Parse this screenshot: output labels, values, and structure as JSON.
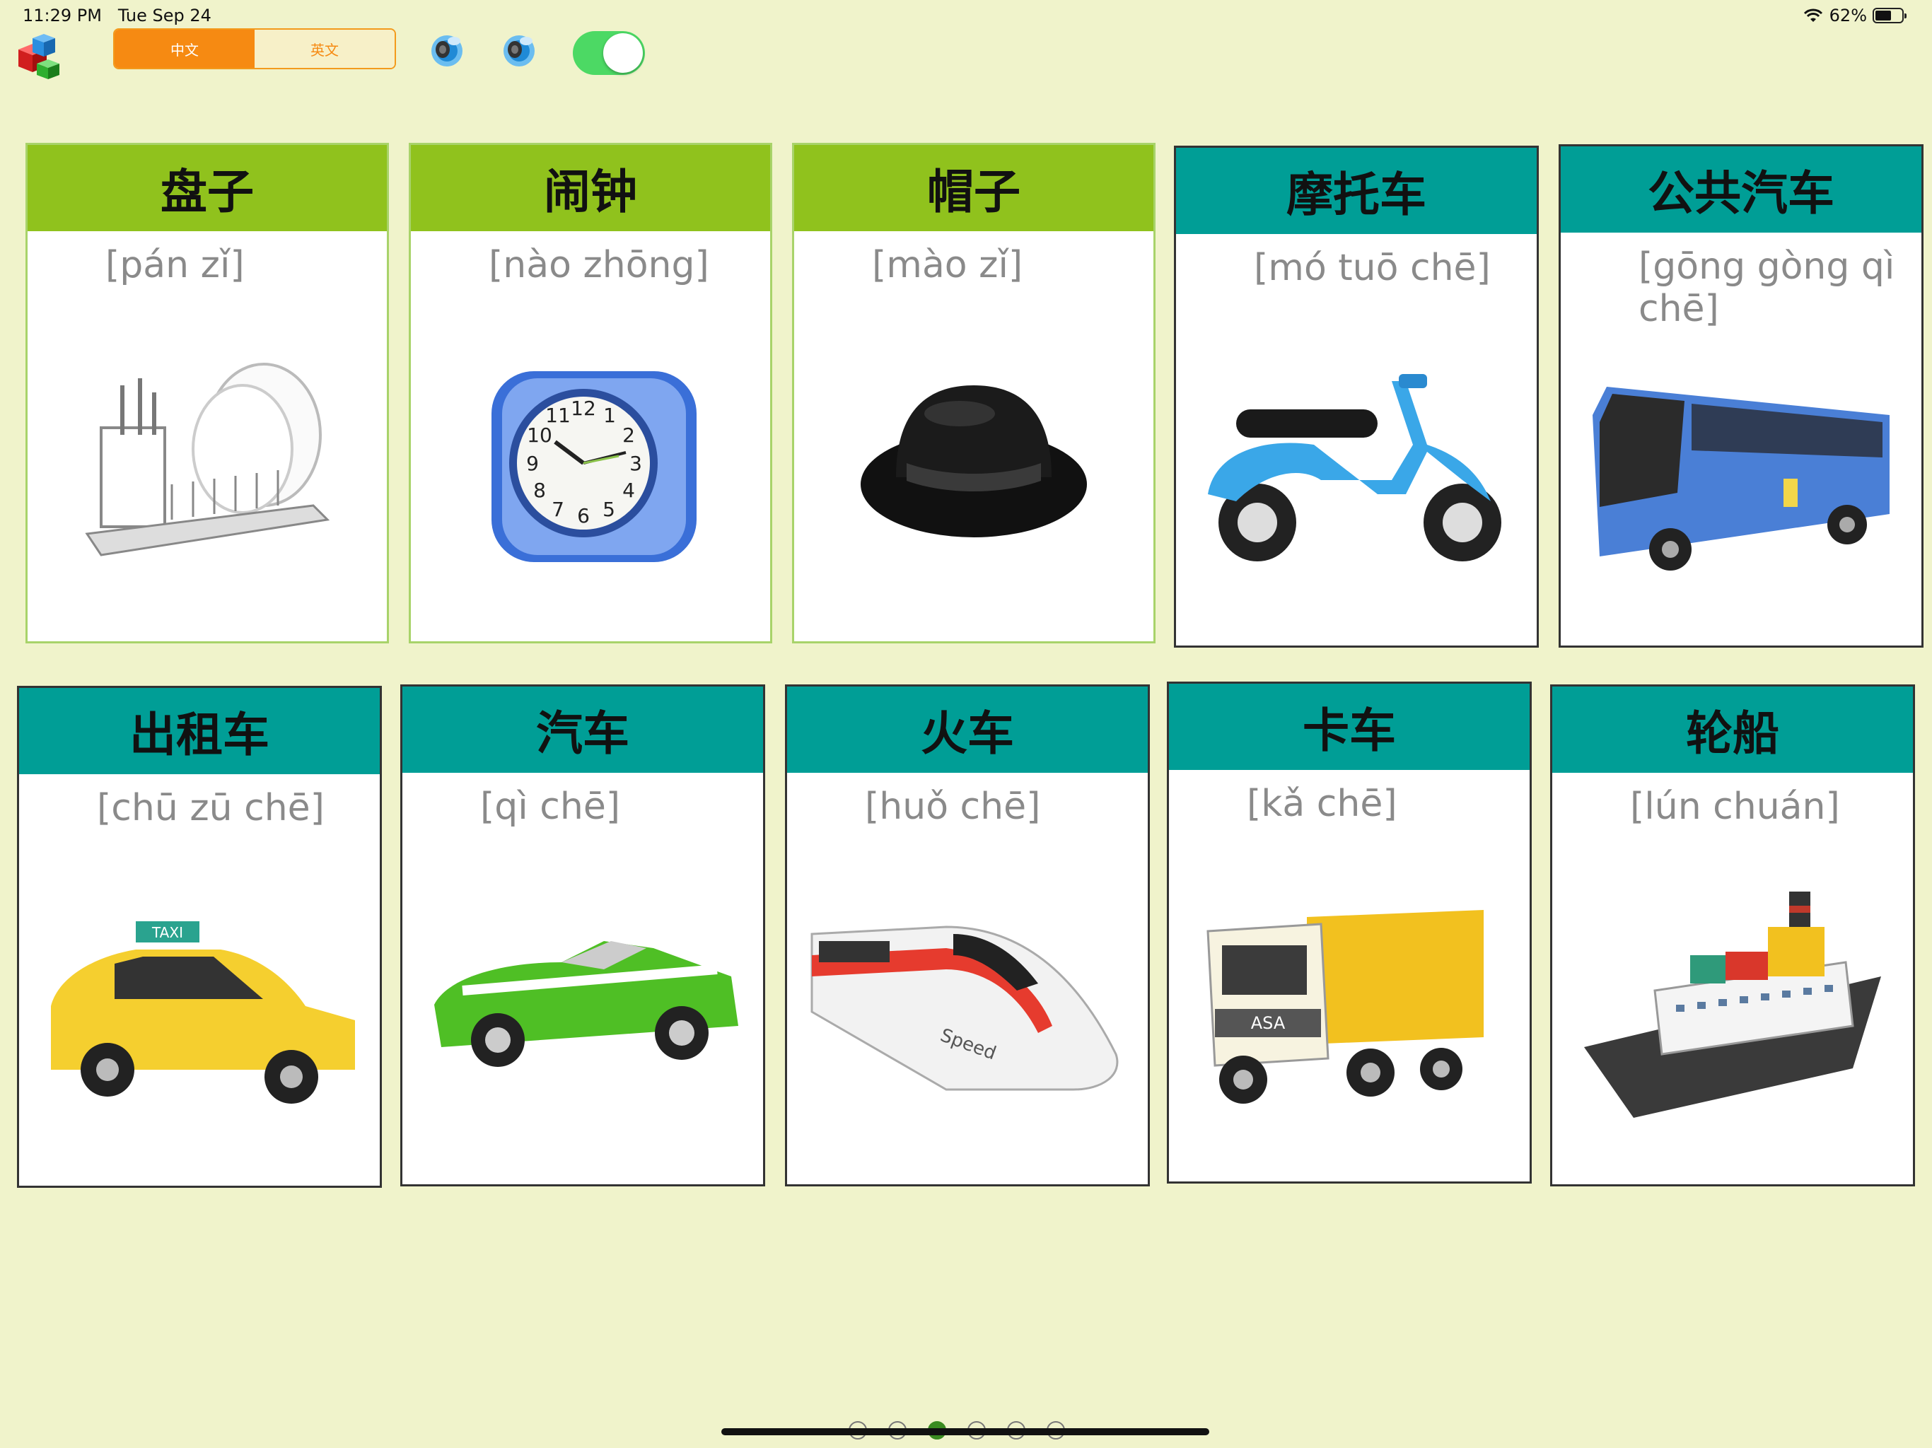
{
  "status": {
    "time": "11:29 PM",
    "date": "Tue Sep 24",
    "battery": "62%",
    "battery_level": 0.62
  },
  "toolbar": {
    "lang_chinese": "中文",
    "lang_english": "英文"
  },
  "cards": [
    {
      "hanzi": "盘子",
      "pinyin": "[pán zǐ]",
      "icon": "dish-rack-icon"
    },
    {
      "hanzi": "闹钟",
      "pinyin": "[nào zhōng]",
      "icon": "alarm-clock-icon"
    },
    {
      "hanzi": "帽子",
      "pinyin": "[mào zǐ]",
      "icon": "hat-icon"
    },
    {
      "hanzi": "摩托车",
      "pinyin": "[mó tuō chē]",
      "icon": "scooter-icon"
    },
    {
      "hanzi": "公共汽车",
      "pinyin": "[gōng gòng qì chē]",
      "icon": "bus-icon"
    },
    {
      "hanzi": "出租车",
      "pinyin": "[chū zū chē]",
      "icon": "taxi-icon"
    },
    {
      "hanzi": "汽车",
      "pinyin": "[qì chē]",
      "icon": "car-icon"
    },
    {
      "hanzi": "火车",
      "pinyin": "[huǒ chē]",
      "icon": "train-icon"
    },
    {
      "hanzi": "卡车",
      "pinyin": "[kǎ chē]",
      "icon": "truck-icon"
    },
    {
      "hanzi": "轮船",
      "pinyin": "[lún chuán]",
      "icon": "ship-icon"
    }
  ],
  "image_text": {
    "clock_numbers": [
      "12",
      "1",
      "2",
      "3",
      "4",
      "5",
      "6",
      "7",
      "8",
      "9",
      "10",
      "11"
    ],
    "taxi_sign": "TAXI",
    "train_text": "Speed",
    "truck_text": "ASA"
  },
  "pager": {
    "count": 6,
    "active": 3
  },
  "colors": {
    "background": "#f0f3cb",
    "green_header": "#90c21d",
    "teal_header": "#009e96",
    "segment_orange": "#f68a12",
    "toggle_on": "#4cd964"
  }
}
